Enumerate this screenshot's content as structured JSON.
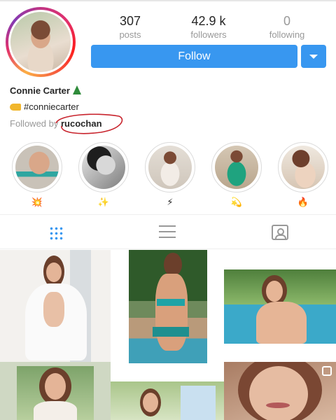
{
  "profile": {
    "name": "Connie Carter",
    "hashtag": "#conniecarter",
    "followed_by_prefix": "Followed by",
    "followed_by_user": "rucochan"
  },
  "stats": [
    {
      "value": "307",
      "label": "posts"
    },
    {
      "value": "42.9 k",
      "label": "followers"
    },
    {
      "value": "0",
      "label": "following"
    }
  ],
  "actions": {
    "follow_label": "Follow"
  },
  "highlights": [
    {
      "emoji": "💥"
    },
    {
      "emoji": "✨"
    },
    {
      "emoji": "⚡"
    },
    {
      "emoji": "💫"
    },
    {
      "emoji": "🔥"
    }
  ],
  "tabs": [
    "grid-icon",
    "list-icon",
    "tagged-icon"
  ],
  "colors": {
    "accent": "#3897f0",
    "muted": "#999999",
    "annotation": "#c8232c"
  }
}
